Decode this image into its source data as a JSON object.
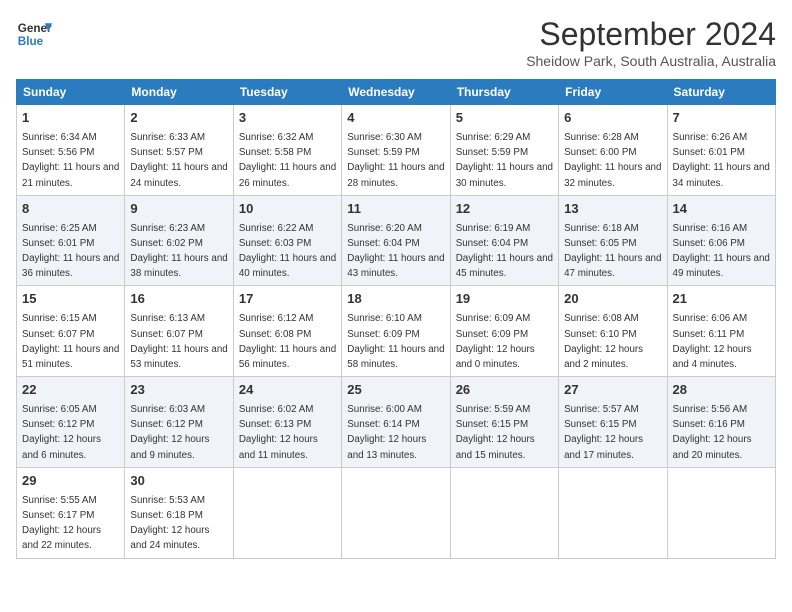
{
  "header": {
    "logo_line1": "General",
    "logo_line2": "Blue",
    "month": "September 2024",
    "location": "Sheidow Park, South Australia, Australia"
  },
  "weekdays": [
    "Sunday",
    "Monday",
    "Tuesday",
    "Wednesday",
    "Thursday",
    "Friday",
    "Saturday"
  ],
  "weeks": [
    [
      {
        "day": "1",
        "sunrise": "6:34 AM",
        "sunset": "5:56 PM",
        "daylight": "11 hours and 21 minutes."
      },
      {
        "day": "2",
        "sunrise": "6:33 AM",
        "sunset": "5:57 PM",
        "daylight": "11 hours and 24 minutes."
      },
      {
        "day": "3",
        "sunrise": "6:32 AM",
        "sunset": "5:58 PM",
        "daylight": "11 hours and 26 minutes."
      },
      {
        "day": "4",
        "sunrise": "6:30 AM",
        "sunset": "5:59 PM",
        "daylight": "11 hours and 28 minutes."
      },
      {
        "day": "5",
        "sunrise": "6:29 AM",
        "sunset": "5:59 PM",
        "daylight": "11 hours and 30 minutes."
      },
      {
        "day": "6",
        "sunrise": "6:28 AM",
        "sunset": "6:00 PM",
        "daylight": "11 hours and 32 minutes."
      },
      {
        "day": "7",
        "sunrise": "6:26 AM",
        "sunset": "6:01 PM",
        "daylight": "11 hours and 34 minutes."
      }
    ],
    [
      {
        "day": "8",
        "sunrise": "6:25 AM",
        "sunset": "6:01 PM",
        "daylight": "11 hours and 36 minutes."
      },
      {
        "day": "9",
        "sunrise": "6:23 AM",
        "sunset": "6:02 PM",
        "daylight": "11 hours and 38 minutes."
      },
      {
        "day": "10",
        "sunrise": "6:22 AM",
        "sunset": "6:03 PM",
        "daylight": "11 hours and 40 minutes."
      },
      {
        "day": "11",
        "sunrise": "6:20 AM",
        "sunset": "6:04 PM",
        "daylight": "11 hours and 43 minutes."
      },
      {
        "day": "12",
        "sunrise": "6:19 AM",
        "sunset": "6:04 PM",
        "daylight": "11 hours and 45 minutes."
      },
      {
        "day": "13",
        "sunrise": "6:18 AM",
        "sunset": "6:05 PM",
        "daylight": "11 hours and 47 minutes."
      },
      {
        "day": "14",
        "sunrise": "6:16 AM",
        "sunset": "6:06 PM",
        "daylight": "11 hours and 49 minutes."
      }
    ],
    [
      {
        "day": "15",
        "sunrise": "6:15 AM",
        "sunset": "6:07 PM",
        "daylight": "11 hours and 51 minutes."
      },
      {
        "day": "16",
        "sunrise": "6:13 AM",
        "sunset": "6:07 PM",
        "daylight": "11 hours and 53 minutes."
      },
      {
        "day": "17",
        "sunrise": "6:12 AM",
        "sunset": "6:08 PM",
        "daylight": "11 hours and 56 minutes."
      },
      {
        "day": "18",
        "sunrise": "6:10 AM",
        "sunset": "6:09 PM",
        "daylight": "11 hours and 58 minutes."
      },
      {
        "day": "19",
        "sunrise": "6:09 AM",
        "sunset": "6:09 PM",
        "daylight": "12 hours and 0 minutes."
      },
      {
        "day": "20",
        "sunrise": "6:08 AM",
        "sunset": "6:10 PM",
        "daylight": "12 hours and 2 minutes."
      },
      {
        "day": "21",
        "sunrise": "6:06 AM",
        "sunset": "6:11 PM",
        "daylight": "12 hours and 4 minutes."
      }
    ],
    [
      {
        "day": "22",
        "sunrise": "6:05 AM",
        "sunset": "6:12 PM",
        "daylight": "12 hours and 6 minutes."
      },
      {
        "day": "23",
        "sunrise": "6:03 AM",
        "sunset": "6:12 PM",
        "daylight": "12 hours and 9 minutes."
      },
      {
        "day": "24",
        "sunrise": "6:02 AM",
        "sunset": "6:13 PM",
        "daylight": "12 hours and 11 minutes."
      },
      {
        "day": "25",
        "sunrise": "6:00 AM",
        "sunset": "6:14 PM",
        "daylight": "12 hours and 13 minutes."
      },
      {
        "day": "26",
        "sunrise": "5:59 AM",
        "sunset": "6:15 PM",
        "daylight": "12 hours and 15 minutes."
      },
      {
        "day": "27",
        "sunrise": "5:57 AM",
        "sunset": "6:15 PM",
        "daylight": "12 hours and 17 minutes."
      },
      {
        "day": "28",
        "sunrise": "5:56 AM",
        "sunset": "6:16 PM",
        "daylight": "12 hours and 20 minutes."
      }
    ],
    [
      {
        "day": "29",
        "sunrise": "5:55 AM",
        "sunset": "6:17 PM",
        "daylight": "12 hours and 22 minutes."
      },
      {
        "day": "30",
        "sunrise": "5:53 AM",
        "sunset": "6:18 PM",
        "daylight": "12 hours and 24 minutes."
      },
      null,
      null,
      null,
      null,
      null
    ]
  ]
}
